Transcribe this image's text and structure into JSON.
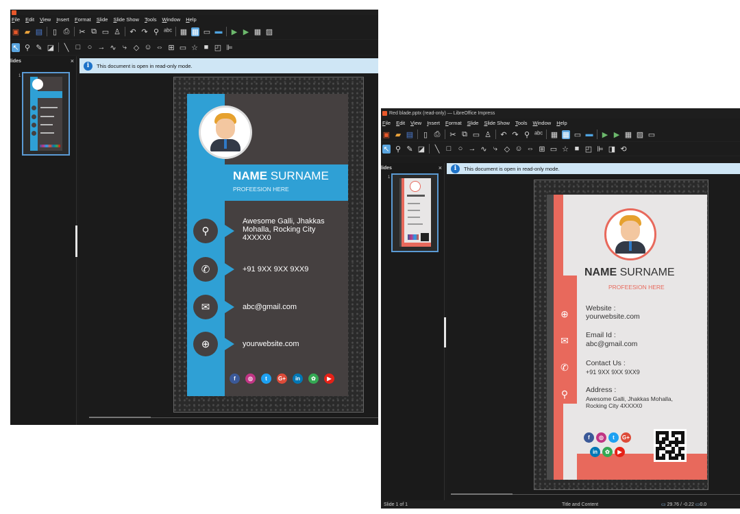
{
  "window1": {
    "menu": [
      "File",
      "Edit",
      "View",
      "Insert",
      "Format",
      "Slide",
      "Slide Show",
      "Tools",
      "Window",
      "Help"
    ],
    "panel_title": "lides",
    "panel_close": "×",
    "info_text": "This document is open in read-only mode.",
    "thumb_number": "1",
    "card": {
      "name_bold": "NAME",
      "name_rest": "SURNAME",
      "profession": "PROFEESION HERE",
      "address": "Awesome Galli, Jhakkas\nMohalla, Rocking City\n4XXXX0",
      "phone": "+91 9XX 9XX 9XX9",
      "email": "abc@gmail.com",
      "website": "yourwebsite.com",
      "social": [
        "f",
        "◎",
        "t",
        "G+",
        "in",
        "✿",
        "▶"
      ]
    }
  },
  "window2": {
    "title": "Red blade.pptx (read-only) — LibreOffice Impress",
    "menu": [
      "File",
      "Edit",
      "View",
      "Insert",
      "Format",
      "Slide",
      "Slide Show",
      "Tools",
      "Window",
      "Help"
    ],
    "panel_title": "lides",
    "panel_close": "×",
    "info_text": "This document is open in read-only mode.",
    "thumb_number": "1",
    "card": {
      "name_bold": "NAME",
      "name_rest": "SURNAME",
      "profession": "PROFEESION HERE",
      "website_label": "Website :",
      "website": "yourwebsite.com",
      "email_label": "Email Id :",
      "email": "abc@gmail.com",
      "contact_label": "Contact Us :",
      "phone": "+91 9XX 9XX 9XX9",
      "address_label": "Address :",
      "address": "Awesome Galli, Jhakkas Mohalla,\nRocking City 4XXXX0",
      "social": [
        "f",
        "◎",
        "t",
        "G+",
        "in",
        "✿",
        "▶"
      ]
    },
    "status": {
      "slide": "Slide 1 of 1",
      "layout": "Title and Content",
      "coords": "29.76 / -0.22",
      "extra": "0.0"
    }
  },
  "colors": {
    "blue_accent": "#2fa0d5",
    "red_accent": "#e8695c",
    "info_bar": "#cfe6f5"
  }
}
